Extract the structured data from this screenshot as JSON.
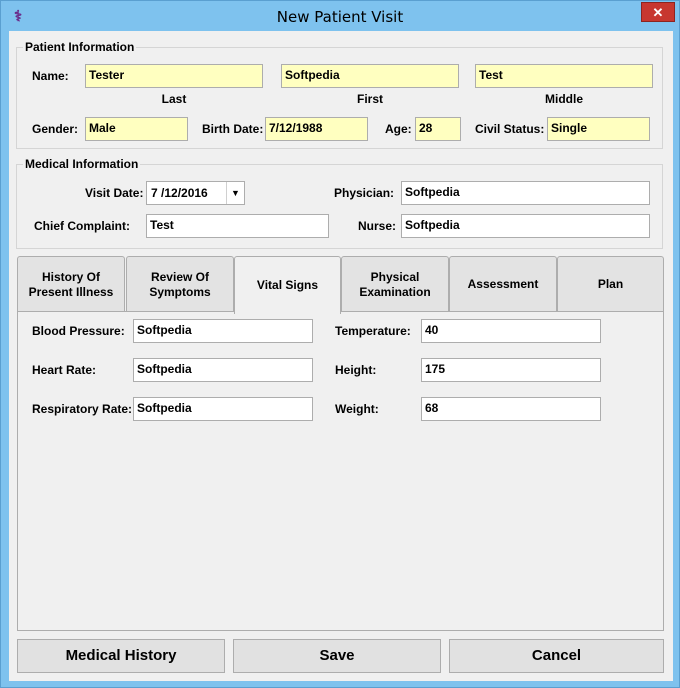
{
  "window": {
    "title": "New Patient Visit",
    "close_glyph": "✕",
    "icon_glyph": "⚕"
  },
  "patient_info": {
    "group_title": "Patient Information",
    "name_label": "Name:",
    "last_value": "Tester",
    "first_value": "Softpedia",
    "middle_value": "Test",
    "last_caption": "Last",
    "first_caption": "First",
    "middle_caption": "Middle",
    "gender_label": "Gender:",
    "gender_value": "Male",
    "birth_date_label": "Birth Date:",
    "birth_date_value": "7/12/1988",
    "age_label": "Age:",
    "age_value": "28",
    "civil_status_label": "Civil Status:",
    "civil_status_value": "Single"
  },
  "medical_info": {
    "group_title": "Medical Information",
    "visit_date_label": "Visit Date:",
    "visit_date_value": "7 /12/2016",
    "physician_label": "Physician:",
    "physician_value": "Softpedia",
    "chief_complaint_label": "Chief Complaint:",
    "chief_complaint_value": "Test",
    "nurse_label": "Nurse:",
    "nurse_value": "Softpedia"
  },
  "tabs": [
    {
      "line1": "History Of",
      "line2": "Present Illness"
    },
    {
      "line1": "Review Of",
      "line2": "Symptoms"
    },
    {
      "line1": "Vital Signs",
      "line2": ""
    },
    {
      "line1": "Physical",
      "line2": "Examination"
    },
    {
      "line1": "Assessment",
      "line2": ""
    },
    {
      "line1": "Plan",
      "line2": ""
    }
  ],
  "active_tab": "Vital Signs",
  "vitals": {
    "blood_pressure_label": "Blood Pressure:",
    "blood_pressure_value": "Softpedia",
    "heart_rate_label": "Heart Rate:",
    "heart_rate_value": "Softpedia",
    "respiratory_rate_label": "Respiratory Rate:",
    "respiratory_rate_value": "Softpedia",
    "temperature_label": "Temperature:",
    "temperature_value": "40",
    "height_label": "Height:",
    "height_value": "175",
    "weight_label": "Weight:",
    "weight_value": "68"
  },
  "buttons": {
    "medical_history": "Medical History",
    "save": "Save",
    "cancel": "Cancel"
  },
  "colors": {
    "highlight_field": "#ffffc0",
    "close_button": "#c7372f",
    "frame": "#7ec2ee"
  }
}
